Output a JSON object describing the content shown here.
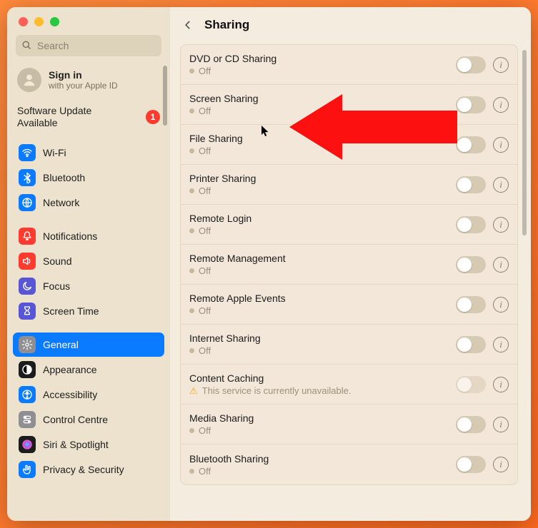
{
  "traffic_lights": {
    "close": "close",
    "minimize": "minimize",
    "maximize": "maximize"
  },
  "search": {
    "placeholder": "Search"
  },
  "signin": {
    "title": "Sign in",
    "subtitle": "with your Apple ID"
  },
  "software_update": {
    "line1": "Software Update",
    "line2": "Available",
    "badge": "1"
  },
  "sidebar_groups": [
    {
      "items": [
        {
          "id": "wifi",
          "label": "Wi-Fi",
          "icon_bg": "#0a7aff",
          "glyph": "wifi"
        },
        {
          "id": "bluetooth",
          "label": "Bluetooth",
          "icon_bg": "#0a7aff",
          "glyph": "bluetooth"
        },
        {
          "id": "network",
          "label": "Network",
          "icon_bg": "#0a7aff",
          "glyph": "globe"
        }
      ]
    },
    {
      "items": [
        {
          "id": "notifications",
          "label": "Notifications",
          "icon_bg": "#ff3b30",
          "glyph": "bell"
        },
        {
          "id": "sound",
          "label": "Sound",
          "icon_bg": "#ff3b30",
          "glyph": "speaker"
        },
        {
          "id": "focus",
          "label": "Focus",
          "icon_bg": "#5856d6",
          "glyph": "moon"
        },
        {
          "id": "screentime",
          "label": "Screen Time",
          "icon_bg": "#5856d6",
          "glyph": "hourglass"
        }
      ]
    },
    {
      "items": [
        {
          "id": "general",
          "label": "General",
          "icon_bg": "#8e8e93",
          "glyph": "gear",
          "active": true
        },
        {
          "id": "appearance",
          "label": "Appearance",
          "icon_bg": "#1c1c1e",
          "glyph": "appearance"
        },
        {
          "id": "accessibility",
          "label": "Accessibility",
          "icon_bg": "#0a7aff",
          "glyph": "accessibility"
        },
        {
          "id": "controlcentre",
          "label": "Control Centre",
          "icon_bg": "#8e8e93",
          "glyph": "switches"
        },
        {
          "id": "siri",
          "label": "Siri & Spotlight",
          "icon_bg": "#1c1c1e",
          "glyph": "siri"
        },
        {
          "id": "privacy",
          "label": "Privacy & Security",
          "icon_bg": "#0a7aff",
          "glyph": "hand"
        }
      ]
    }
  ],
  "header": {
    "title": "Sharing"
  },
  "rows": [
    {
      "id": "dvd",
      "title": "DVD or CD Sharing",
      "status": "Off",
      "status_kind": "dot",
      "toggle_enabled": true
    },
    {
      "id": "screen",
      "title": "Screen Sharing",
      "status": "Off",
      "status_kind": "dot",
      "toggle_enabled": true
    },
    {
      "id": "file",
      "title": "File Sharing",
      "status": "Off",
      "status_kind": "dot",
      "toggle_enabled": true
    },
    {
      "id": "printer",
      "title": "Printer Sharing",
      "status": "Off",
      "status_kind": "dot",
      "toggle_enabled": true
    },
    {
      "id": "remotelogin",
      "title": "Remote Login",
      "status": "Off",
      "status_kind": "dot",
      "toggle_enabled": true
    },
    {
      "id": "remotemgmt",
      "title": "Remote Management",
      "status": "Off",
      "status_kind": "dot",
      "toggle_enabled": true
    },
    {
      "id": "remoteapple",
      "title": "Remote Apple Events",
      "status": "Off",
      "status_kind": "dot",
      "toggle_enabled": true
    },
    {
      "id": "internet",
      "title": "Internet Sharing",
      "status": "Off",
      "status_kind": "dot",
      "toggle_enabled": true
    },
    {
      "id": "contentcaching",
      "title": "Content Caching",
      "status": "This service is currently unavailable.",
      "status_kind": "warn",
      "toggle_enabled": false
    },
    {
      "id": "media",
      "title": "Media Sharing",
      "status": "Off",
      "status_kind": "dot",
      "toggle_enabled": true
    },
    {
      "id": "btshare",
      "title": "Bluetooth Sharing",
      "status": "Off",
      "status_kind": "dot",
      "toggle_enabled": true
    }
  ],
  "info_glyph": "i"
}
